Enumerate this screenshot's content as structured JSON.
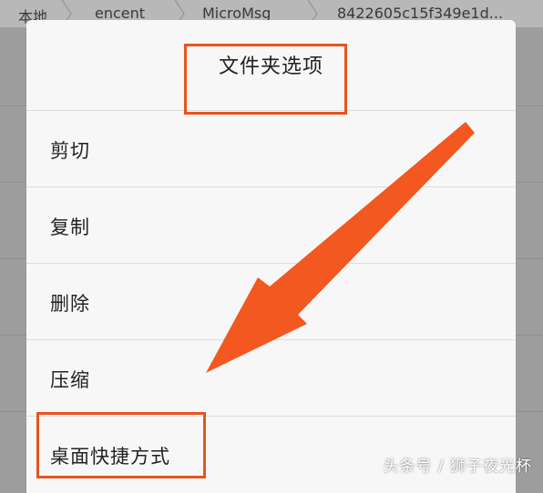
{
  "breadcrumb": {
    "items": [
      "本地",
      "encent",
      "MicroMsg",
      "8422605c15f349e1d..."
    ]
  },
  "dialog": {
    "title": "文件夹选项",
    "items": [
      {
        "label": "剪切"
      },
      {
        "label": "复制"
      },
      {
        "label": "删除"
      },
      {
        "label": "压缩"
      },
      {
        "label": "桌面快捷方式"
      }
    ]
  },
  "annotations": {
    "highlight_color": "#e8531d",
    "arrow_color": "#f2581f"
  },
  "watermark": "头条号 / 狮子夜光杯"
}
